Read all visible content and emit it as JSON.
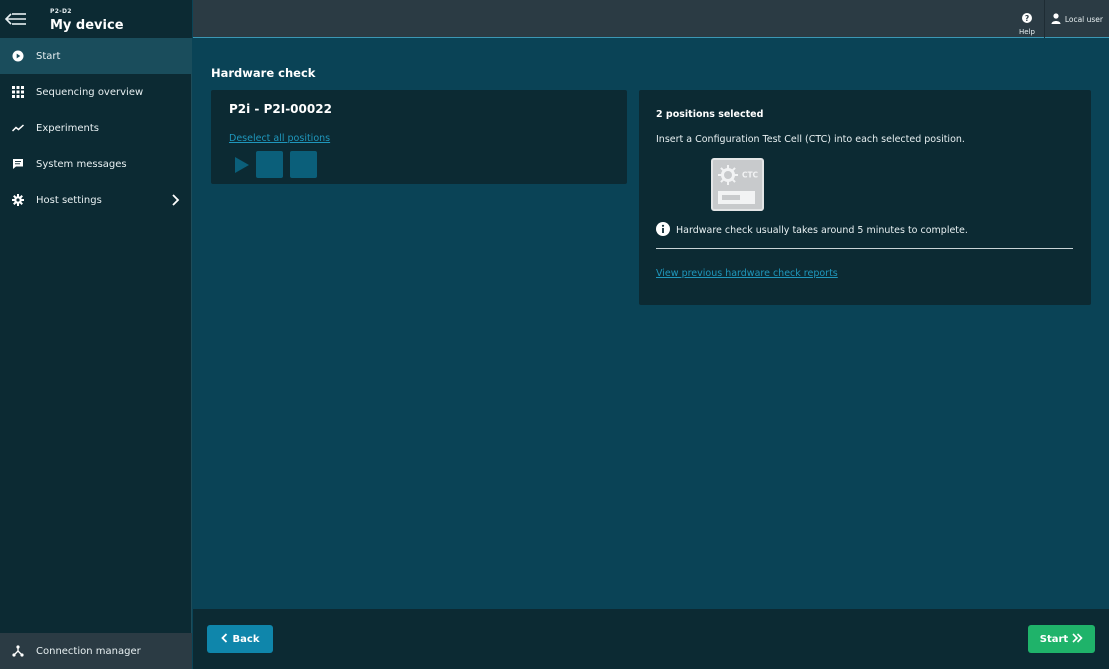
{
  "header": {
    "device_subtitle": "P2-D2",
    "device_title": "My device",
    "help_label": "Help",
    "user_label": "Local user"
  },
  "sidebar": {
    "items": [
      {
        "label": "Start",
        "icon": "play-circle-icon",
        "active": true
      },
      {
        "label": "Sequencing overview",
        "icon": "grid-icon",
        "active": false
      },
      {
        "label": "Experiments",
        "icon": "trend-line-icon",
        "active": false
      },
      {
        "label": "System messages",
        "icon": "message-icon",
        "active": false
      },
      {
        "label": "Host settings",
        "icon": "gear-icon",
        "active": false,
        "has_submenu": true
      }
    ],
    "footer_item": {
      "label": "Connection manager",
      "icon": "network-icon"
    }
  },
  "main": {
    "title": "Hardware check",
    "instrument": {
      "name": "P2i - P2I-00022",
      "deselect_label": "Deselect all positions",
      "positions_selected": 2
    },
    "details": {
      "selected_title": "2 positions selected",
      "instruction": "Insert a Configuration Test Cell (CTC) into each selected position.",
      "ctc_label": "CTC",
      "info_text": "Hardware check usually takes around 5 minutes to complete.",
      "reports_link": "View previous hardware check reports"
    }
  },
  "footer": {
    "back_label": "Back",
    "start_label": "Start"
  },
  "colors": {
    "background": "#0a4356",
    "panel": "#0c2a33",
    "topbar": "#2b3b44",
    "link": "#1f97bc",
    "primary_button": "#0f86ab",
    "start_button": "#1fb36a",
    "position_tile": "#0b5f7a"
  }
}
